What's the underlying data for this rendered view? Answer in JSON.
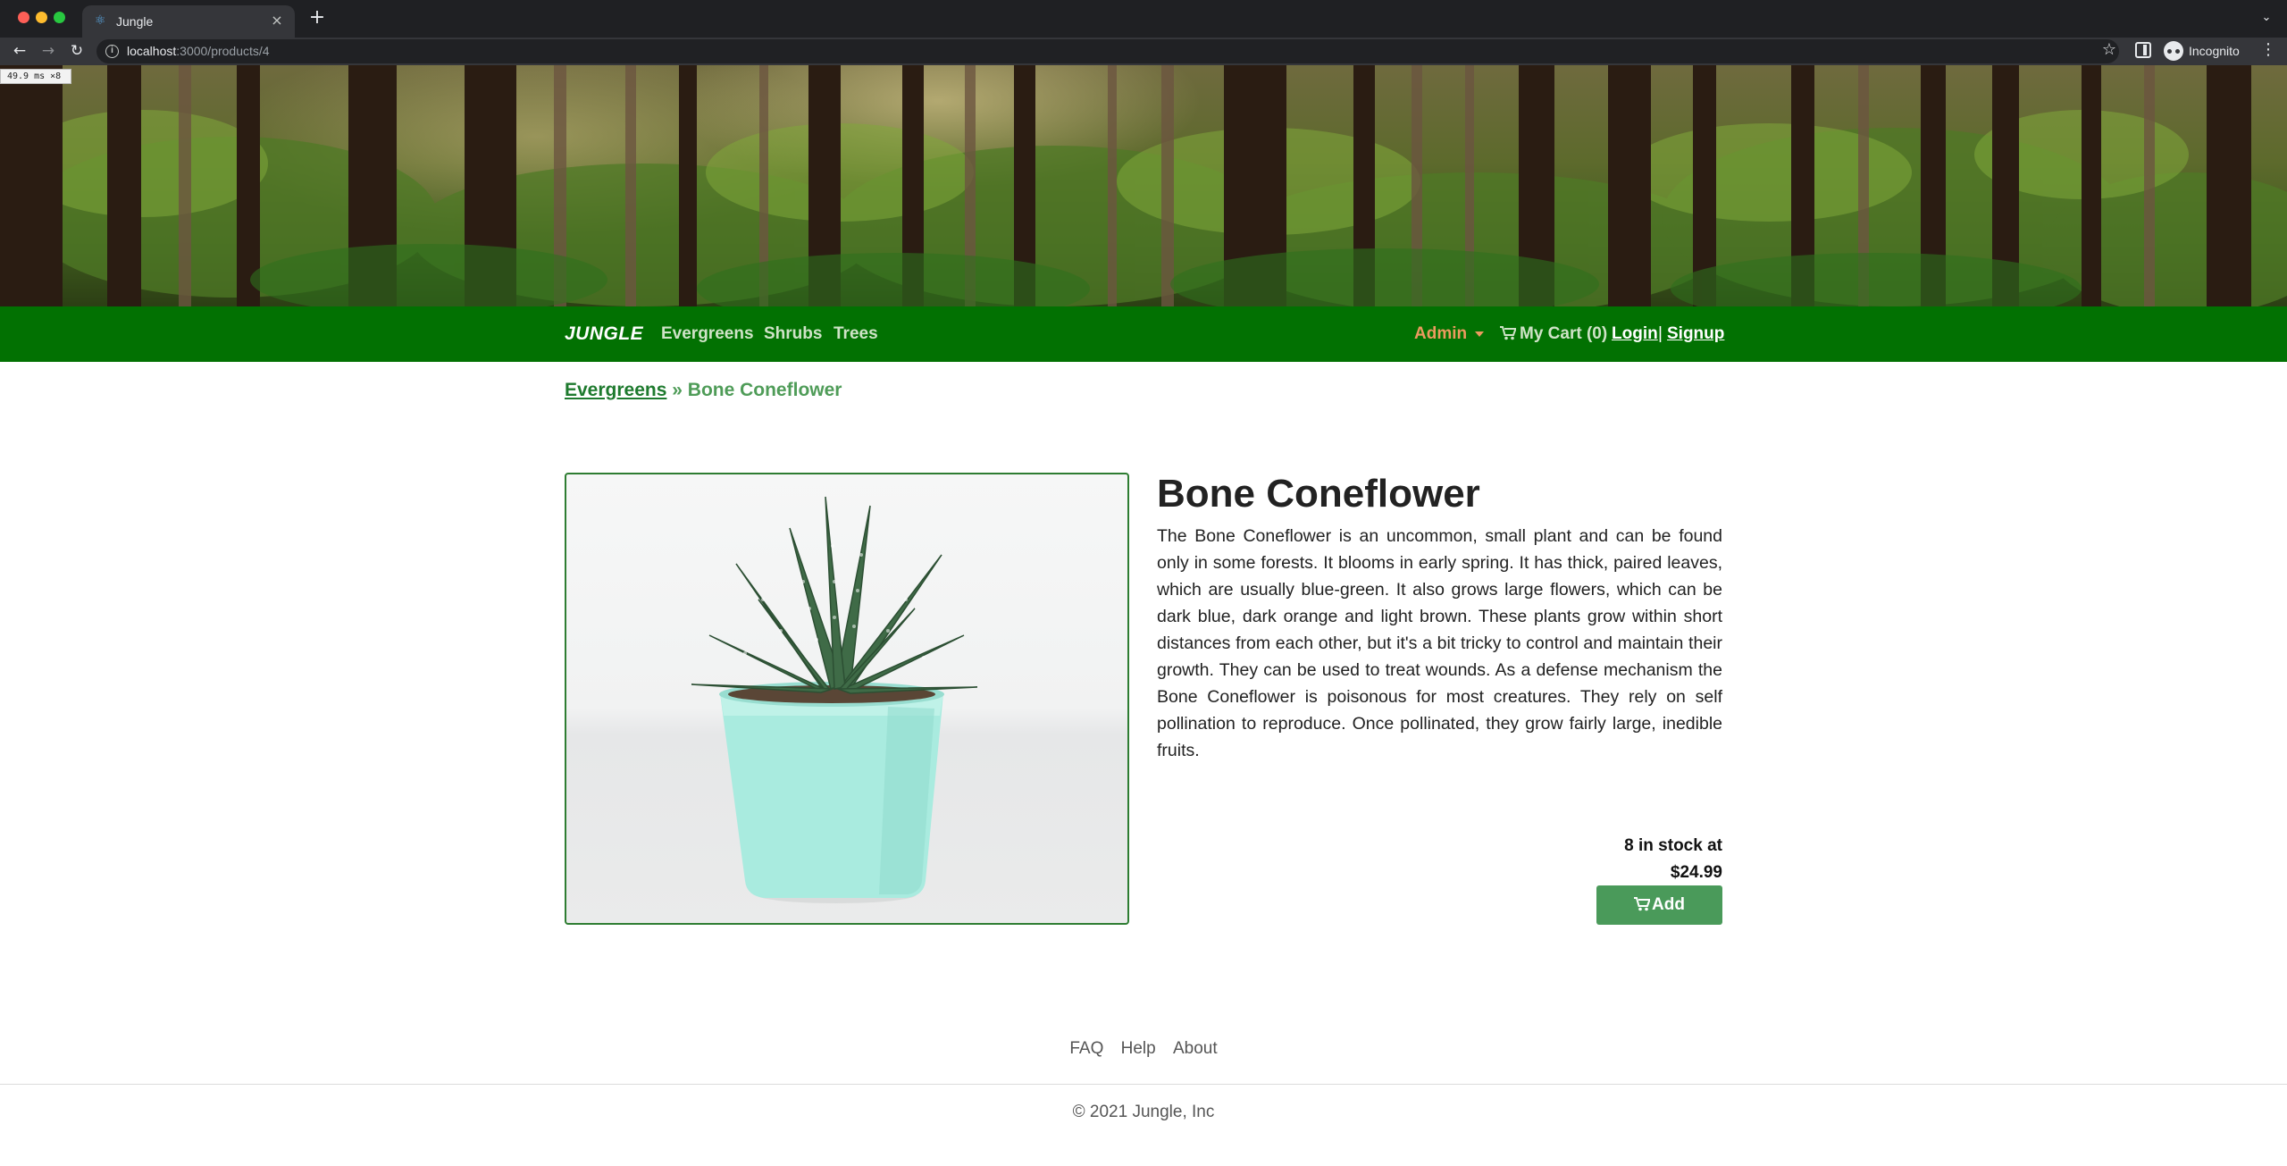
{
  "browser": {
    "tab_title": "Jungle",
    "url_host": "localhost",
    "url_path": ":3000/products/4",
    "profile_label": "Incognito",
    "perf_badge": "49.9 ms ×8"
  },
  "navbar": {
    "brand": "JUNGLE",
    "categories": [
      {
        "label": "Evergreens"
      },
      {
        "label": "Shrubs"
      },
      {
        "label": "Trees"
      }
    ],
    "admin_label": "Admin",
    "cart_label": "My Cart (0)",
    "login_label": "Login",
    "separator": "|",
    "signup_label": "Signup"
  },
  "breadcrumb": {
    "category": "Evergreens",
    "separator": "»",
    "current": "Bone Coneflower"
  },
  "product": {
    "name": "Bone Coneflower",
    "description": "The Bone Coneflower is an uncommon, small plant and can be found only in some forests. It blooms in early spring. It has thick, paired leaves, which are usually blue-green. It also grows large flowers, which can be dark blue, dark orange and light brown. These plants grow within short distances from each other, but it's a bit tricky to control and maintain their growth. They can be used to treat wounds. As a defense mechanism the Bone Coneflower is poisonous for most creatures. They rely on self pollination to reproduce. Once pollinated, they grow fairly large, inedible fruits.",
    "stock_text": "8 in stock at",
    "price": "$24.99",
    "add_label": "Add"
  },
  "footer": {
    "links": [
      {
        "label": "FAQ"
      },
      {
        "label": "Help"
      },
      {
        "label": "About"
      }
    ],
    "copyright": "© 2021 Jungle, Inc"
  },
  "colors": {
    "navbar_bg": "#027102",
    "admin": "#ec9a5f",
    "add_button": "#4a9a5a",
    "breadcrumb_link": "#1e7a2e"
  },
  "icons": [
    "info-icon",
    "star-icon",
    "side-panel-icon",
    "incognito-icon",
    "menu-icon",
    "cart-icon",
    "chevron-down-icon"
  ]
}
